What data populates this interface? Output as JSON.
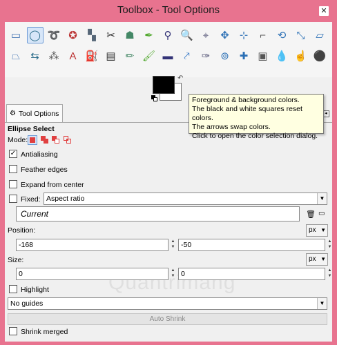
{
  "window": {
    "title": "Toolbox - Tool Options",
    "close": "✕"
  },
  "tools": [
    {
      "icon": "rect-select-icon",
      "glyph": "▭"
    },
    {
      "icon": "ellipse-select-icon",
      "glyph": "◯"
    },
    {
      "icon": "free-select-icon",
      "glyph": "➰"
    },
    {
      "icon": "fuzzy-select-icon",
      "glyph": "✪"
    },
    {
      "icon": "color-select-icon",
      "glyph": "▚"
    },
    {
      "icon": "scissors-icon",
      "glyph": "✂"
    },
    {
      "icon": "foreground-select-icon",
      "glyph": "☗"
    },
    {
      "icon": "paths-icon",
      "glyph": "✒"
    },
    {
      "icon": "color-picker-icon",
      "glyph": "⚲"
    },
    {
      "icon": "zoom-icon",
      "glyph": "🔍"
    },
    {
      "icon": "measure-icon",
      "glyph": "⌖"
    },
    {
      "icon": "move-icon",
      "glyph": "✥"
    },
    {
      "icon": "align-icon",
      "glyph": "⊹"
    },
    {
      "icon": "crop-icon",
      "glyph": "⌐"
    },
    {
      "icon": "rotate-icon",
      "glyph": "⟲"
    },
    {
      "icon": "scale-icon",
      "glyph": "⤡"
    },
    {
      "icon": "shear-icon",
      "glyph": "▱"
    },
    {
      "icon": "perspective-icon",
      "glyph": "⏢"
    },
    {
      "icon": "flip-icon",
      "glyph": "⇆"
    },
    {
      "icon": "cage-icon",
      "glyph": "⁂"
    },
    {
      "icon": "text-icon",
      "glyph": "A"
    },
    {
      "icon": "bucket-fill-icon",
      "glyph": "⛽"
    },
    {
      "icon": "blend-icon",
      "glyph": "▤"
    },
    {
      "icon": "pencil-icon",
      "glyph": "✏"
    },
    {
      "icon": "paintbrush-icon",
      "glyph": "🖌"
    },
    {
      "icon": "eraser-icon",
      "glyph": "▬"
    },
    {
      "icon": "airbrush-icon",
      "glyph": "⤤"
    },
    {
      "icon": "ink-icon",
      "glyph": "✑"
    },
    {
      "icon": "clone-icon",
      "glyph": "⊚"
    },
    {
      "icon": "heal-icon",
      "glyph": "✚"
    },
    {
      "icon": "perspective-clone-icon",
      "glyph": "▣"
    },
    {
      "icon": "blur-icon",
      "glyph": "💧"
    },
    {
      "icon": "smudge-icon",
      "glyph": "☝"
    },
    {
      "icon": "dodge-burn-icon",
      "glyph": "⚫"
    }
  ],
  "tooltip": {
    "line1": "Foreground & background colors.",
    "line2": "The black and white squares reset colors.",
    "line3": "The arrows swap colors.",
    "line4": "Click to open the color selection dialog."
  },
  "tab": {
    "label": "Tool Options"
  },
  "options": {
    "heading": "Ellipse Select",
    "mode_label": "Mode:",
    "antialiasing": {
      "label": "Antialiasing",
      "checked": true
    },
    "feather": {
      "label": "Feather edges",
      "checked": false
    },
    "expand": {
      "label": "Expand from center",
      "checked": false
    },
    "fixed": {
      "label": "Fixed:",
      "checked": false,
      "value": "Aspect ratio"
    },
    "current": "Current",
    "position": {
      "label": "Position:",
      "unit": "px",
      "x": "-168",
      "y": "-50"
    },
    "size": {
      "label": "Size:",
      "unit": "px",
      "w": "0",
      "h": "0"
    },
    "highlight": {
      "label": "Highlight",
      "checked": false
    },
    "guides": "No guides",
    "auto_shrink": "Auto Shrink",
    "shrink_merged": {
      "label": "Shrink merged",
      "checked": false
    }
  },
  "watermark": "Quantrimang"
}
